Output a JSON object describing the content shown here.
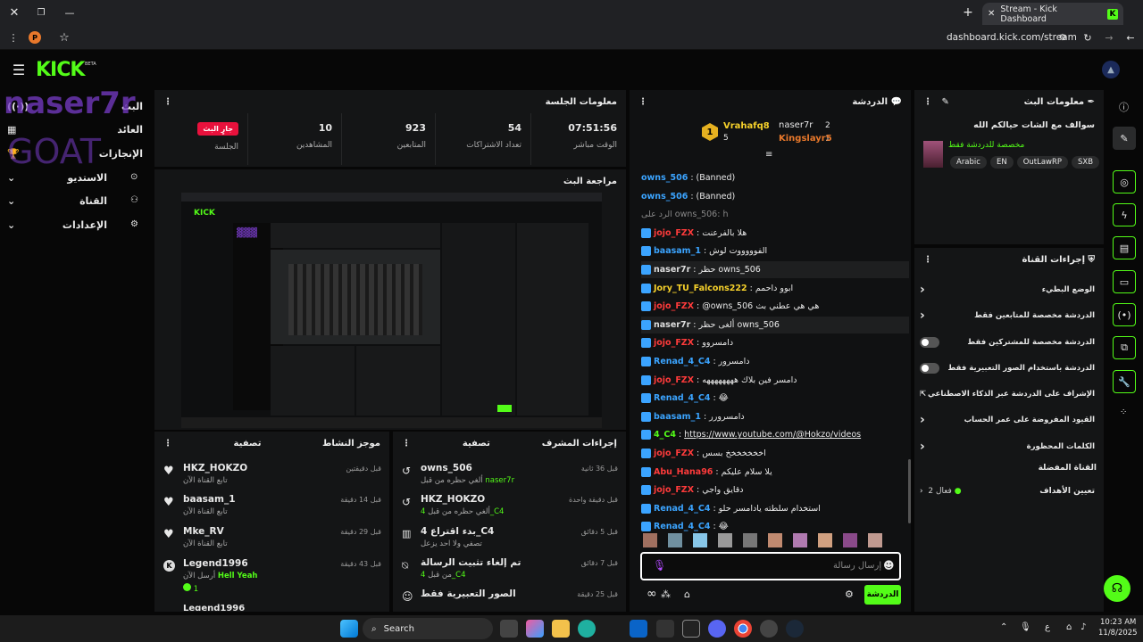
{
  "browser": {
    "tab_title": "Stream - Kick Dashboard",
    "url": "dashboard.kick.com/stream",
    "profile_initial": "P"
  },
  "app": {
    "logo": "KICK",
    "beta": "BETA",
    "watermark_line1": "naser7r",
    "watermark_line2": "GOAT"
  },
  "sidebar": {
    "items": [
      {
        "label": "البث",
        "icon": "broadcast-icon"
      },
      {
        "label": "العائد",
        "icon": "money-icon"
      },
      {
        "label": "الإنجازات",
        "icon": "trophy-icon"
      },
      {
        "label": "الاستديو",
        "icon": "studio-icon"
      },
      {
        "label": "القناة",
        "icon": "channel-icon"
      },
      {
        "label": "الإعدادات",
        "icon": "gear-icon"
      }
    ]
  },
  "session": {
    "title": "معلومات الجلسة",
    "status": "جارٍ البث",
    "session_label": "الجلسة",
    "viewers": "10",
    "viewers_label": "المشاهدين",
    "followers": "923",
    "followers_label": "المتابعين",
    "subs": "54",
    "subs_label": "تعداد الاشتراكات",
    "uptime": "07:51:56",
    "uptime_label": "الوقت مباشر"
  },
  "preview": {
    "title": "مراجعة البث"
  },
  "activity": {
    "title": "موجز النشاط",
    "filter": "تصفية",
    "items": [
      {
        "name": "HKZ_HOKZO",
        "sub": "تابع القناة الآن",
        "time": "قبل دقيقتين",
        "icon": "heart-icon"
      },
      {
        "name": "baasam_1",
        "sub": "تابع القناة الآن",
        "time": "قبل 14 دقيقة",
        "icon": "heart-icon"
      },
      {
        "name": "Mke_RV",
        "sub": "تابع القناة الآن",
        "time": "قبل 29 دقيقة",
        "icon": "heart-icon"
      },
      {
        "name": "Legend1996",
        "sub": "أرسل الآن",
        "time": "قبل 43 دقيقة",
        "icon": "kick-icon",
        "extra": "Hell Yeah",
        "count": "1"
      },
      {
        "name": "Legend1996",
        "sub": "",
        "time": "",
        "icon": "kick-icon"
      }
    ]
  },
  "modactions": {
    "title": "إجراءات المشرف",
    "filter": "تصفية",
    "items": [
      {
        "name": "owns_506",
        "sub": "ألغي حظره من قبل",
        "by": "naser7r",
        "time": "قبل 36 ثانية"
      },
      {
        "name": "HKZ_HOKZO",
        "sub": "ألغي حظره من قبل",
        "by": "4_C4",
        "time": "قبل دقيقة واحدة"
      },
      {
        "name": "بدء اقتراع 4_C4",
        "sub": "تصفي ولا احد يزعل",
        "by": "",
        "time": "قبل 5 دقائق"
      },
      {
        "name": "تم إلغاء تثبيت الرسالة",
        "sub": "من قبل",
        "by": "4_C4",
        "time": "قبل 7 دقائق"
      },
      {
        "name": "الصور التعبيرية فقط",
        "sub": "",
        "by": "",
        "time": "قبل 25 دقيقة"
      }
    ]
  },
  "chat": {
    "title": "الدردشة",
    "top": [
      {
        "name": "Vrahafq8",
        "count": "5",
        "rank": "1"
      },
      {
        "name": "naser7r",
        "count": "2"
      },
      {
        "name": "Kingslayr5",
        "count": "1"
      }
    ],
    "messages": [
      {
        "user": "owns_506",
        "text": "(Banned)",
        "color": "#3ba4ff"
      },
      {
        "user": "owns_506",
        "text": "(Banned)",
        "color": "#3ba4ff"
      },
      {
        "user": "",
        "text": "الرد على owns_506: h",
        "color": "#888"
      },
      {
        "user": "jojo_FZX",
        "text": "هلا بالفرعنت",
        "color": "#ff3b3b"
      },
      {
        "user": "baasam_1",
        "text": "الفوووووت لوش",
        "color": "#3ba4ff"
      },
      {
        "user": "naser7r",
        "text": "حظر owns_506",
        "color": "#ddd"
      },
      {
        "user": "Jory_TU_Falcons222",
        "text": "ابوو داحمم",
        "color": "#f6d12b"
      },
      {
        "user": "jojo_FZX",
        "text": "@owns_506 هي هي عطني بث",
        "color": "#ff3b3b"
      },
      {
        "user": "naser7r",
        "text": "ألغى حظر owns_506",
        "color": "#ddd"
      },
      {
        "user": "jojo_FZX",
        "text": "دامسروو",
        "color": "#ff3b3b"
      },
      {
        "user": "Renad_4_C4",
        "text": "دامسرور",
        "color": "#3ba4ff"
      },
      {
        "user": "jojo_FZX",
        "text": "دامسر فين بلاك ههههههههه",
        "color": "#ff3b3b"
      },
      {
        "user": "Renad_4_C4",
        "text": "😂",
        "color": "#3ba4ff"
      },
      {
        "user": "baasam_1",
        "text": "دامسرورر",
        "color": "#3ba4ff"
      },
      {
        "user": "4_C4",
        "text": "https://www.youtube.com/@Hokzo/videos",
        "color": "#53fc18"
      },
      {
        "user": "jojo_FZX",
        "text": "اخخخخخخخ بسس",
        "color": "#ff3b3b"
      },
      {
        "user": "Abu_Hana96",
        "text": "يلا سلام عليكم",
        "color": "#ff3b3b"
      },
      {
        "user": "jojo_FZX",
        "text": "دقايق واجي",
        "color": "#ff3b3b"
      },
      {
        "user": "Renad_4_C4",
        "text": "استخدام سلطته يادامسر حلو",
        "color": "#3ba4ff"
      },
      {
        "user": "Renad_4_C4",
        "text": "😂",
        "color": "#3ba4ff"
      }
    ],
    "input_placeholder": "إرسال رسالة",
    "send": "الدردشة"
  },
  "streaminfo": {
    "title": "معلومات البث",
    "stream_title": "سوالف مع الشات حيالكم الله",
    "category": "مخصصة للدردشة فقط",
    "tags": [
      "Arabic",
      "EN",
      "OutLawRP",
      "SXB"
    ]
  },
  "channelactions": {
    "title": "إجراءات القناة",
    "items": [
      {
        "label": "الوضع البطيء",
        "kind": "arrow"
      },
      {
        "label": "الدردشة مخصصة للمتابعين فقط",
        "kind": "arrow"
      },
      {
        "label": "الدردشة مخصصة للمشتركين فقط",
        "kind": "toggle"
      },
      {
        "label": "الدردشة باستخدام الصور التعبيرية فقط",
        "kind": "toggle"
      },
      {
        "label": "الإشراف على الدردشة عبر الذكاء الاصطناعي",
        "kind": "ext"
      },
      {
        "label": "القيود المفروضة على عمر الحساب",
        "kind": "arrow"
      },
      {
        "label": "الكلمات المحظورة",
        "kind": "arrow"
      }
    ],
    "favorite": "القناة المفضلة",
    "goals": "تعيين الأهداف",
    "goals_count": "فعال 2"
  },
  "taskbar": {
    "search": "Search",
    "time": "10:23 AM",
    "date": "11/8/2025",
    "lang": "ع"
  }
}
